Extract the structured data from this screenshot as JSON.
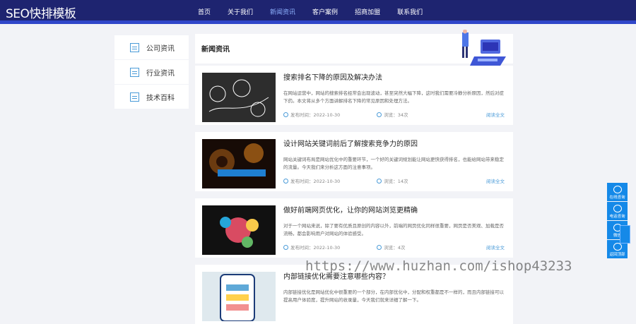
{
  "header": {
    "logo": "SEO快排模板",
    "nav": [
      "首页",
      "关于我们",
      "新闻资讯",
      "客户案例",
      "招商加盟",
      "联系我们"
    ],
    "active_nav_index": 2
  },
  "sidebar": {
    "items": [
      {
        "label": "公司资讯"
      },
      {
        "label": "行业资讯"
      },
      {
        "label": "技术百科"
      }
    ]
  },
  "content": {
    "title": "新闻资讯",
    "articles": [
      {
        "title": "搜索排名下降的原因及解决办法",
        "desc": "在网站运营中，网站的搜索排名经常会出现波动，甚至突然大幅下降，这时我们需要冷静分析原因，然后对症下药。本文将从多个方面讲解排名下降的常见原因和处理方法。",
        "meta_date_label": "发布时间：2022-10-30",
        "meta_views_label": "浏览：34次",
        "read_more": "阅读全文"
      },
      {
        "title": "设计网站关键词前后了解搜索竞争力的原因",
        "desc": "网站关键词布局是网站优化中的重要环节，一个好的关键词规划能让网站更快获得排名，也能给网站带来稳定的流量。今天我们来分析这方面的注意事项。",
        "meta_date_label": "发布时间：2022-10-30",
        "meta_views_label": "浏览：14次",
        "read_more": "阅读全文"
      },
      {
        "title": "做好前端网页优化，让你的网站浏览更精确",
        "desc": "对于一个网站来说，除了要有优质且原创的内容以外，前端的网页优化同样很重要，网页是否美观、加载是否流畅，都会影响用户对网站的体验感受。",
        "meta_date_label": "发布时间：2022-10-30",
        "meta_views_label": "浏览：4次",
        "read_more": "阅读全文"
      },
      {
        "title": "内部链接优化需要注意哪些内容？",
        "desc": "内部链接优化是网站优化中很重要的一个部分，在内部优化中，分配和权重都是不一样的，而且内部链接可以提高用户体验度，提升网站的收录量，今天我们就来详细了解一下。",
        "meta_date_label": "",
        "meta_views_label": "",
        "read_more": ""
      }
    ]
  },
  "float_bar": [
    "在线咨询",
    "电话咨询",
    "微信",
    "返回顶部"
  ],
  "watermark": "https://www.huzhan.com/ishop43233",
  "colors": {
    "header_bg": "#1e2470",
    "accent": "#2f46c9",
    "float_bar": "#1589e8"
  }
}
